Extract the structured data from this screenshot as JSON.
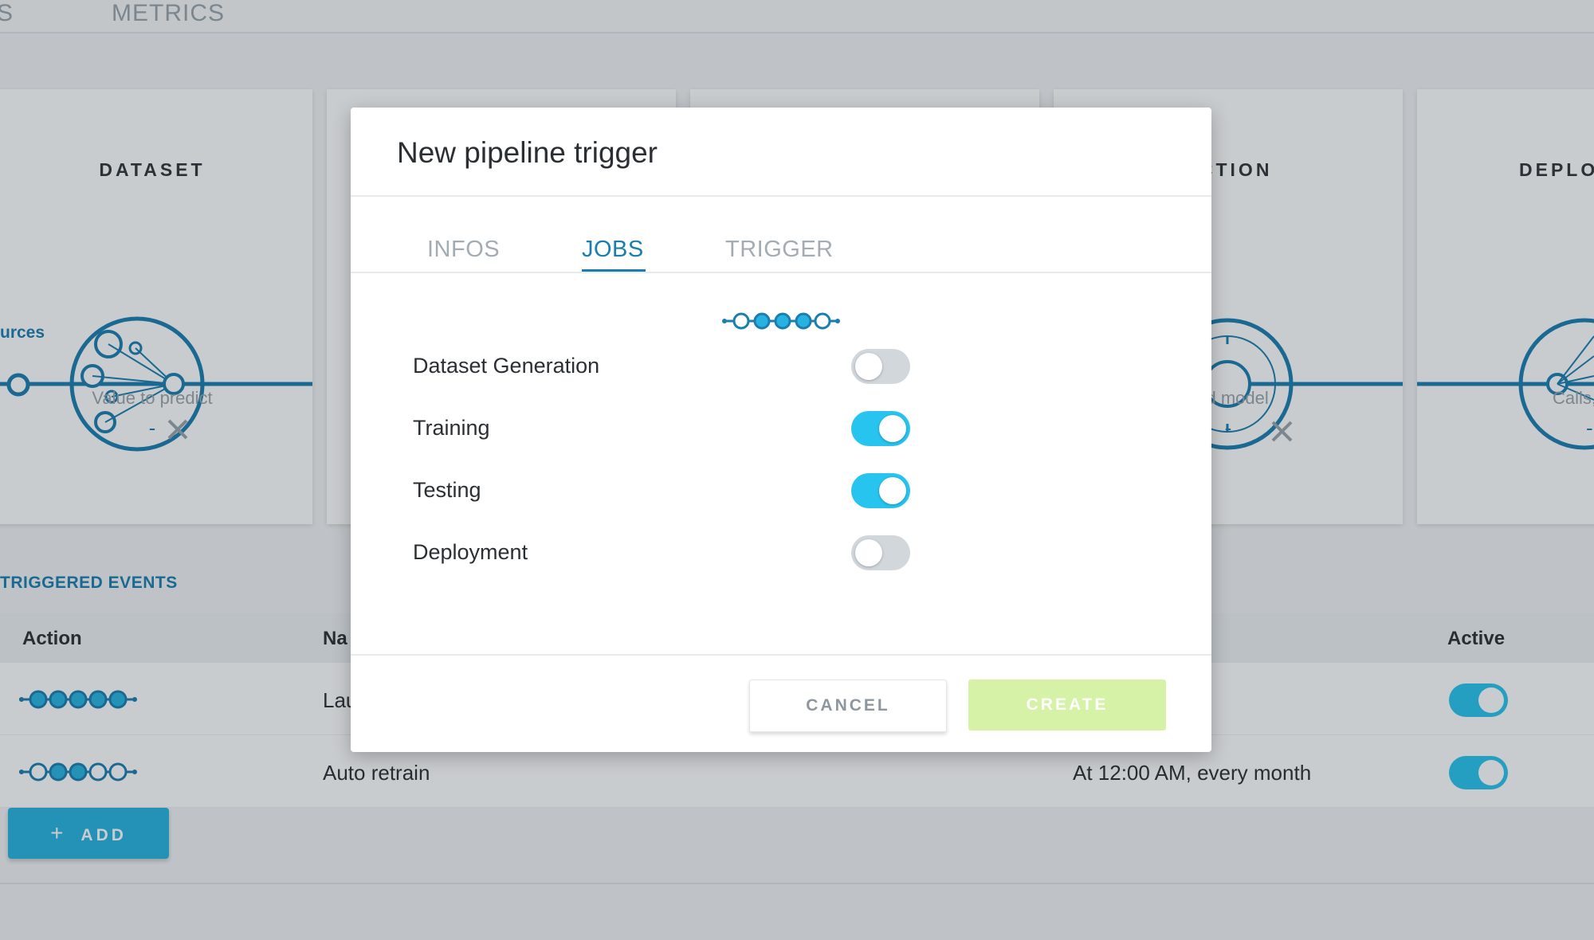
{
  "top_tabs": [
    "S",
    "METRICS"
  ],
  "pipeline_cards": [
    {
      "title": "DATASET",
      "caption": "Value to predict",
      "value": "-",
      "node_label": "urces"
    },
    {
      "title": "",
      "caption": "",
      "value": ""
    },
    {
      "title": "",
      "caption": "",
      "value": ""
    },
    {
      "title": "ECTION",
      "caption": "yed model",
      "value": "-"
    },
    {
      "title": "DEPLOY",
      "caption": "Calls,",
      "value": "-"
    }
  ],
  "triggered_events": {
    "title": "TRIGGERED EVENTS",
    "columns": {
      "action": "Action",
      "name": "Na",
      "active": "Active"
    },
    "rows": [
      {
        "name": "Lau",
        "schedule": "",
        "active": true
      },
      {
        "name": "Auto retrain",
        "schedule": "At 12:00 AM, every month",
        "active": true
      }
    ],
    "add_label": "ADD",
    "add_icon": "+"
  },
  "modal": {
    "title": "New pipeline trigger",
    "tabs": [
      {
        "label": "INFOS",
        "active": false
      },
      {
        "label": "JOBS",
        "active": true
      },
      {
        "label": "TRIGGER",
        "active": false
      }
    ],
    "jobs": [
      {
        "label": "Dataset Generation",
        "enabled": false
      },
      {
        "label": "Training",
        "enabled": true
      },
      {
        "label": "Testing",
        "enabled": true
      },
      {
        "label": "Deployment",
        "enabled": false
      }
    ],
    "cancel_label": "CANCEL",
    "create_label": "CREATE"
  },
  "colors": {
    "accent": "#1a7eb0",
    "toggle_on": "#27c4ef",
    "toggle_off": "#d2d7dc",
    "create_disabled": "#d6f2a6"
  }
}
